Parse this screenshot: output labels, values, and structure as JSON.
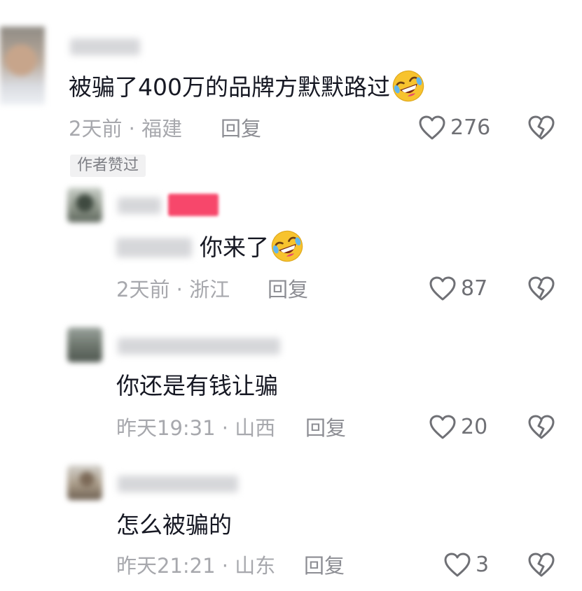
{
  "comments": [
    {
      "text": "被骗了400万的品牌方默默路过",
      "meta": "2天前 · 福建",
      "reply": "回复",
      "likes": "276",
      "badge": "作者赞过"
    },
    {
      "text": "你来了",
      "meta": "2天前 · 浙江",
      "reply": "回复",
      "likes": "87"
    },
    {
      "text": "你还是有钱让骗",
      "meta": "昨天19:31 · 山西",
      "reply": "回复",
      "likes": "20"
    },
    {
      "text": "怎么被骗的",
      "meta": "昨天21:21 · 山东",
      "reply": "回复",
      "likes": "3"
    }
  ],
  "icons": {
    "like": "heart-outline-icon",
    "dislike": "broken-heart-icon",
    "emoji": "rofl-emoji"
  },
  "colors": {
    "text": "#161823",
    "meta": "#a7a8ad",
    "badge_bg": "#f1f1f2",
    "tag_pink": "#f7476b",
    "emoji_yellow": "#f7c32e"
  }
}
